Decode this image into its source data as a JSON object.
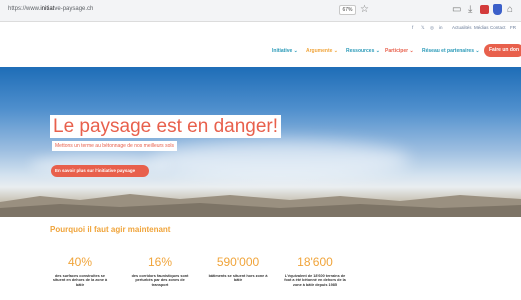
{
  "browser": {
    "url_prefix": "https://www.",
    "url_domain": "initiat",
    "url_rest": "ve-paysage.ch",
    "zoom": "67%",
    "icons": [
      "star-icon",
      "tab-icon",
      "download-icon",
      "extension-icon",
      "profile-icon",
      "home-icon"
    ]
  },
  "topbar": {
    "social": [
      "f",
      "𝕏",
      "◎",
      "in"
    ],
    "links": [
      "Actualités",
      "Médias",
      "Contact",
      "FR"
    ]
  },
  "nav": {
    "items": [
      {
        "label": "Initiative ⌄",
        "color": "#2a9ab8"
      },
      {
        "label": "Argumente ⌄",
        "color": "#f0a43a"
      },
      {
        "label": "Ressources ⌄",
        "color": "#2a9ab8"
      },
      {
        "label": "Participer ⌄",
        "color": "#e8604c"
      },
      {
        "label": "Réseau et partenaires ⌄",
        "color": "#2a9ab8"
      }
    ],
    "cta": "Faire un don"
  },
  "hero": {
    "title": "Le paysage est en danger!",
    "subtitle": "Mettons un terme au bétonnage de nos meilleurs sols",
    "button": "En savoir plus sur l'initiative paysage"
  },
  "why": {
    "title": "Pourquoi il faut agir maintenant",
    "stats": [
      {
        "value": "40%",
        "caption": "des surfaces construites se situent en dehors de la zone à bâtir"
      },
      {
        "value": "16%",
        "caption": "des corridors faunistiques sont perturbés par des zones de transport"
      },
      {
        "value": "590'000",
        "caption": "bâtiments se situent hors zone à bâtir"
      },
      {
        "value": "18'600",
        "caption": "L'équivalent de 18'600 terrains de foot a été bétonné en dehors de la zone à bâtir depuis 1985"
      }
    ]
  },
  "colors": {
    "accent": "#e8604c",
    "orange": "#f0a43a",
    "teal": "#2a9ab8"
  }
}
